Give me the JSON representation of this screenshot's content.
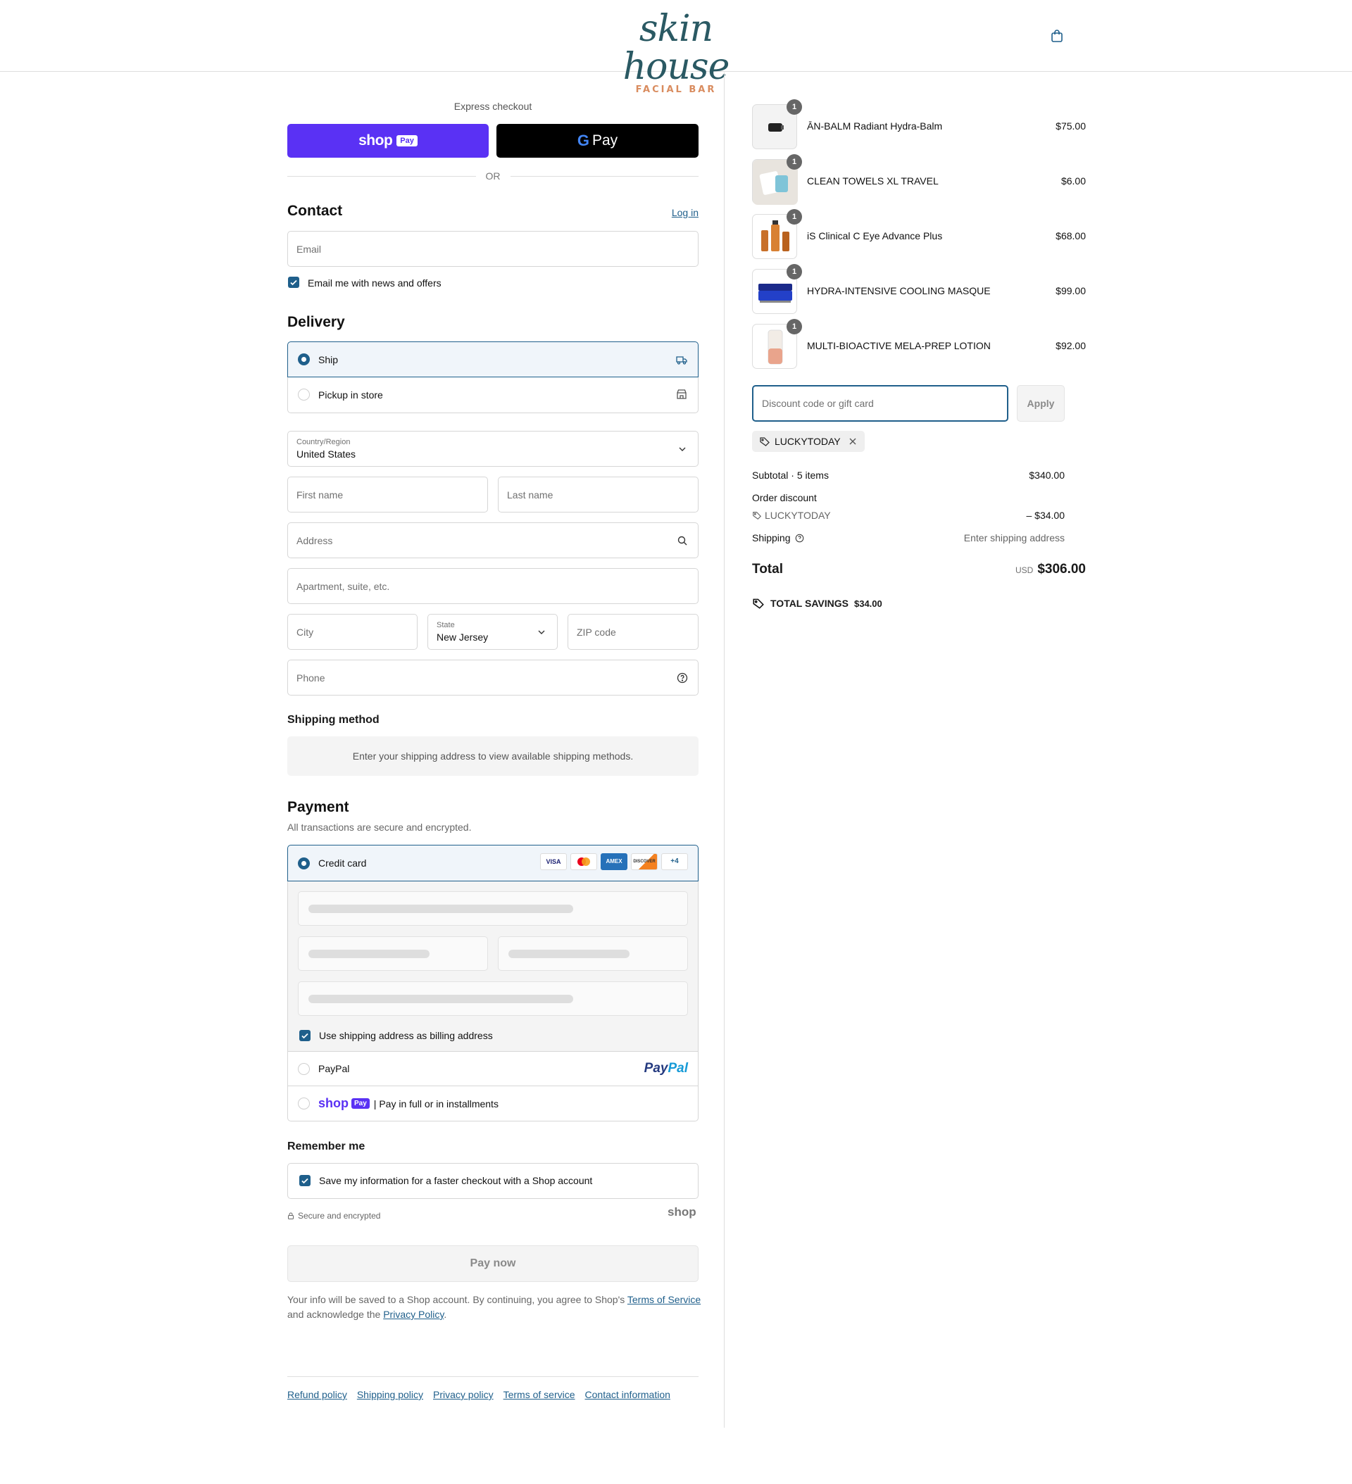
{
  "header": {
    "logo_script": "skin house",
    "logo_sub": "FACIAL BAR"
  },
  "express": {
    "title": "Express checkout",
    "shop_pay_word": "shop",
    "shop_pay_badge": "Pay",
    "gpay_letter": "G",
    "gpay_word": "Pay",
    "or": "OR"
  },
  "contact": {
    "heading": "Contact",
    "login": "Log in",
    "email_placeholder": "Email",
    "newsletter_label": "Email me with news and offers",
    "newsletter_checked": true
  },
  "delivery": {
    "heading": "Delivery",
    "options": [
      {
        "label": "Ship",
        "selected": true,
        "icon": "truck-icon"
      },
      {
        "label": "Pickup in store",
        "selected": false,
        "icon": "store-icon"
      }
    ],
    "country_label": "Country/Region",
    "country_value": "United States",
    "first_name_placeholder": "First name",
    "last_name_placeholder": "Last name",
    "address_placeholder": "Address",
    "apartment_placeholder": "Apartment, suite, etc.",
    "city_placeholder": "City",
    "state_label": "State",
    "state_value": "New Jersey",
    "zip_placeholder": "ZIP code",
    "phone_placeholder": "Phone"
  },
  "shipping_method": {
    "heading": "Shipping method",
    "notice": "Enter your shipping address to view available shipping methods."
  },
  "payment": {
    "heading": "Payment",
    "subtitle": "All transactions are secure and encrypted.",
    "credit_card_label": "Credit card",
    "card_brands": [
      "VISA",
      "",
      "AMEX",
      "DISCOVER",
      "+4"
    ],
    "billing_label": "Use shipping address as billing address",
    "paypal_label": "PayPal",
    "paypal_logo_a": "Pay",
    "paypal_logo_b": "Pal",
    "shoppay_word": "shop",
    "shoppay_badge": "Pay",
    "shoppay_label": "| Pay in full or in installments"
  },
  "remember": {
    "heading": "Remember me",
    "save_label": "Save my information for a faster checkout with a Shop account",
    "secure_label": "Secure and encrypted",
    "shop_mark": "shop"
  },
  "pay_now": "Pay now",
  "legal": {
    "text_a": "Your info will be saved to a Shop account. By continuing, you agree to Shop's ",
    "tos": "Terms of Service",
    "text_b": "and acknowledge the ",
    "privacy": "Privacy Policy",
    "text_c": "."
  },
  "footer_links": [
    "Refund policy",
    "Shipping policy",
    "Privacy policy",
    "Terms of service",
    "Contact information"
  ],
  "order": {
    "items": [
      {
        "name": "ĀN-BALM Radiant Hydra-Balm",
        "price": "$75.00",
        "qty": "1"
      },
      {
        "name": "CLEAN TOWELS XL TRAVEL",
        "price": "$6.00",
        "qty": "1"
      },
      {
        "name": "iS Clinical C Eye Advance Plus",
        "price": "$68.00",
        "qty": "1"
      },
      {
        "name": "HYDRA-INTENSIVE COOLING MASQUE",
        "price": "$99.00",
        "qty": "1"
      },
      {
        "name": "MULTI-BIOACTIVE MELA-PREP LOTION",
        "price": "$92.00",
        "qty": "1"
      }
    ],
    "discount_placeholder": "Discount code or gift card",
    "apply": "Apply",
    "applied_code": "LUCKYTODAY",
    "subtotal_label": "Subtotal · 5 items",
    "subtotal_value": "$340.00",
    "order_discount_label": "Order discount",
    "discount_code": "LUCKYTODAY",
    "discount_value": "– $34.00",
    "shipping_label": "Shipping",
    "shipping_value": "Enter shipping address",
    "total_label": "Total",
    "total_currency": "USD",
    "total_value": "$306.00",
    "savings_label": "TOTAL SAVINGS",
    "savings_value": "$34.00"
  },
  "colors": {
    "accent": "#1f5f8b",
    "shop_pay": "#5a31f4",
    "logo_teal": "#2a5963",
    "logo_orange": "#d98c5f"
  }
}
